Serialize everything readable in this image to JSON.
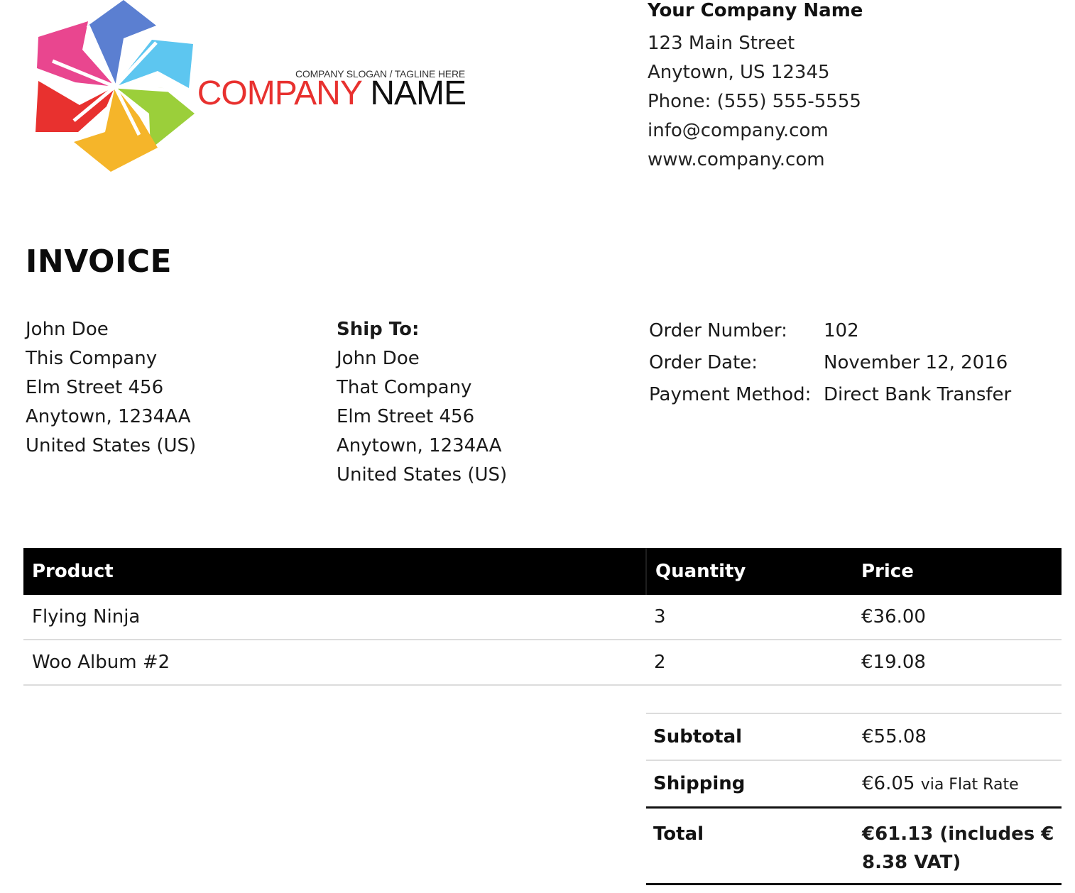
{
  "logo": {
    "tagline": "COMPANY SLOGAN / TAGLINE HERE",
    "name_part1": "COMPANY",
    "name_part2": "NAME",
    "colors": [
      "#e8312f",
      "#e9468f",
      "#5b7fd1",
      "#5dc6f0",
      "#9bcf3a",
      "#f5b52a"
    ]
  },
  "company": {
    "name": "Your Company Name",
    "street": "123 Main Street",
    "city": "Anytown, US 12345",
    "phone": "Phone: (555) 555-5555",
    "email": "info@company.com",
    "website": "www.company.com"
  },
  "title": "INVOICE",
  "bill_to": {
    "lines": [
      "John Doe",
      "This Company",
      "Elm Street 456",
      "Anytown, 1234AA",
      "United States (US)"
    ]
  },
  "ship_to": {
    "label": "Ship To:",
    "lines": [
      "John Doe",
      "That Company",
      "Elm Street 456",
      "Anytown, 1234AA",
      "United States (US)"
    ]
  },
  "order": {
    "number_label": "Order Number:",
    "number": "102",
    "date_label": "Order Date:",
    "date": "November 12, 2016",
    "payment_label": "Payment Method:",
    "payment": "Direct Bank Transfer"
  },
  "table": {
    "headers": [
      "Product",
      "Quantity",
      "Price"
    ],
    "rows": [
      {
        "product": "Flying Ninja",
        "quantity": "3",
        "price": "€36.00"
      },
      {
        "product": "Woo Album #2",
        "quantity": "2",
        "price": "€19.08"
      }
    ]
  },
  "totals": {
    "subtotal_label": "Subtotal",
    "subtotal": "€55.08",
    "shipping_label": "Shipping",
    "shipping": "€6.05",
    "shipping_via": "via Flat Rate",
    "total_label": "Total",
    "total_line1": "€61.13 (includes €",
    "total_line2": "8.38 VAT)"
  }
}
